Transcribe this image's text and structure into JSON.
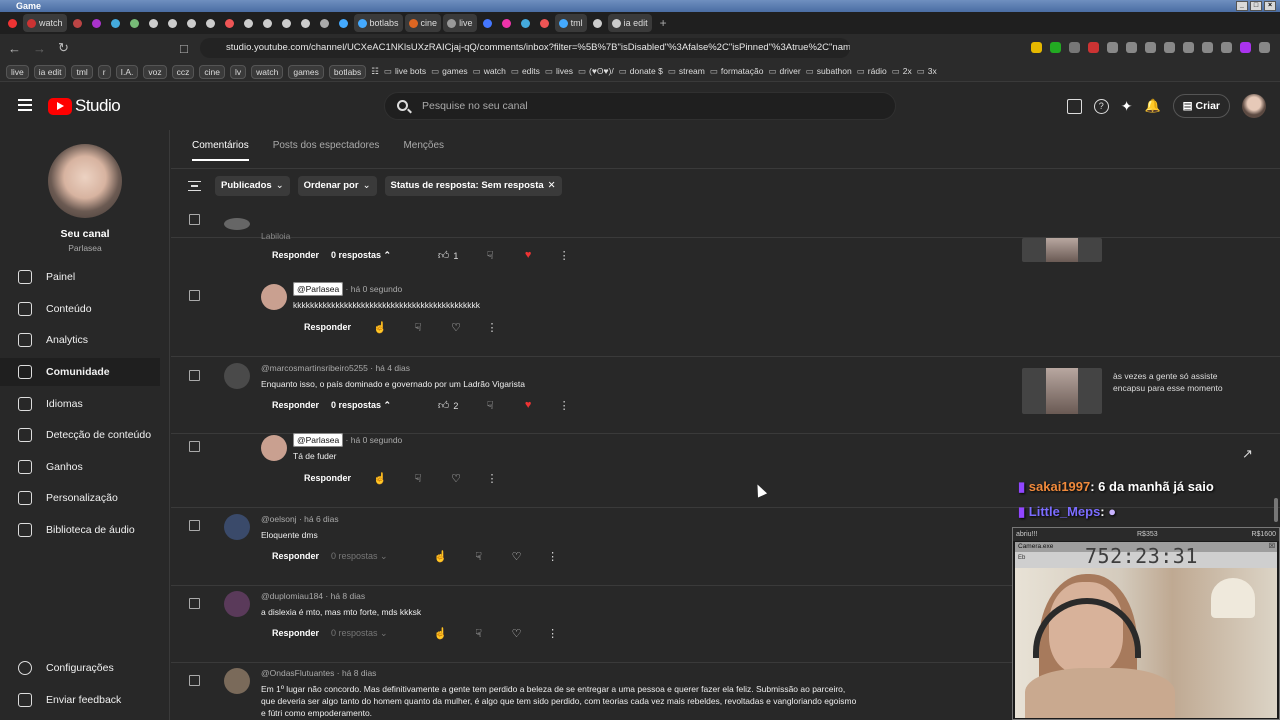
{
  "window": {
    "title": "Game"
  },
  "tabs": [
    {
      "label": "",
      "color": "#e33"
    },
    {
      "label": "watch",
      "color": "#c33",
      "active": true
    },
    {
      "label": "",
      "color": "#b44"
    },
    {
      "label": "",
      "color": "#a3c"
    },
    {
      "label": "",
      "color": "#4ad"
    },
    {
      "label": "",
      "color": "#7b7"
    },
    {
      "label": "",
      "color": "#ccc"
    },
    {
      "label": "",
      "color": "#ccc"
    },
    {
      "label": "",
      "color": "#ccc"
    },
    {
      "label": "",
      "color": "#ccc"
    },
    {
      "label": "",
      "color": "#e55"
    },
    {
      "label": "",
      "color": "#ccc"
    },
    {
      "label": "",
      "color": "#ccc"
    },
    {
      "label": "",
      "color": "#ccc"
    },
    {
      "label": "",
      "color": "#ccc"
    },
    {
      "label": "",
      "color": "#aaa"
    },
    {
      "label": "",
      "color": "#4af"
    },
    {
      "label": "botlabs",
      "color": "#4af"
    },
    {
      "label": "cine",
      "color": "#d62"
    },
    {
      "label": "live",
      "color": "#999"
    },
    {
      "label": "",
      "color": "#47f"
    },
    {
      "label": "",
      "color": "#e3a"
    },
    {
      "label": "",
      "color": "#4ad"
    },
    {
      "label": "",
      "color": "#e55"
    },
    {
      "label": "tml",
      "color": "#4af"
    },
    {
      "label": "",
      "color": "#ccc"
    },
    {
      "label": "ia edit",
      "color": "#ccc"
    }
  ],
  "url": "studio.youtube.com/channel/UCXeAC1NKlsUXzRAICjaj-qQ/comments/inbox?filter=%5B%7B\"isDisabled\"%3Afalse%2C\"isPinned\"%3Atrue%2C\"nam...",
  "bookmarks": {
    "chips": [
      "live",
      "ia edit",
      "tml",
      "r",
      "I.A.",
      "voz",
      "ccz",
      "cine",
      "lv",
      "watch",
      "games",
      "botlabs"
    ],
    "folders": [
      "live bots",
      "games",
      "watch",
      "edits",
      "lives",
      "(♥ʘ♥)/",
      "donate $",
      "stream",
      "formatação",
      "driver",
      "subathon",
      "rádio",
      "2x",
      "3x"
    ]
  },
  "header": {
    "logo": "Studio",
    "search_placeholder": "Pesquise no seu canal",
    "create_label": "Criar"
  },
  "channel": {
    "name": "Seu canal",
    "handle": "Parlasea"
  },
  "nav": [
    {
      "label": "Painel",
      "icon": "dashboard-icon"
    },
    {
      "label": "Conteúdo",
      "icon": "content-icon"
    },
    {
      "label": "Analytics",
      "icon": "analytics-icon"
    },
    {
      "label": "Comunidade",
      "icon": "community-icon",
      "active": true
    },
    {
      "label": "Idiomas",
      "icon": "subtitles-icon"
    },
    {
      "label": "Detecção de conteúdo",
      "icon": "copyright-icon"
    },
    {
      "label": "Ganhos",
      "icon": "dollar-icon"
    },
    {
      "label": "Personalização",
      "icon": "customize-icon"
    },
    {
      "label": "Biblioteca de áudio",
      "icon": "audio-library-icon"
    }
  ],
  "nav_bottom": [
    {
      "label": "Configurações",
      "icon": "gear-icon"
    },
    {
      "label": "Enviar feedback",
      "icon": "feedback-icon"
    }
  ],
  "page_tabs": [
    "Comentários",
    "Posts dos espectadores",
    "Menções"
  ],
  "filters": {
    "published": "Publicados",
    "sort": "Ordenar por",
    "status": "Status de resposta: Sem resposta"
  },
  "labels": {
    "reply": "Responder"
  },
  "comments": [
    {
      "author": "",
      "time": "",
      "text": "Labiloia",
      "replies": "0 respostas",
      "likes": "1",
      "show_replies": true
    },
    {
      "author": "@Parlasea",
      "time": "há 0 segundo",
      "text": "kkkkkkkkkkkkkkkkkkkkkkkkkkkkkkkkkkkkkkkkkkkk",
      "owner": true
    },
    {
      "author": "@marcosmartinsribeiro5255",
      "time": "há 4 dias",
      "text": "Enquanto isso, o país dominado e governado por um Ladrão Vigarista",
      "replies": "0 respostas",
      "likes": "2",
      "show_replies": true
    },
    {
      "author": "@Parlasea",
      "time": "há 0 segundo",
      "text": "Tá de fuder",
      "owner": true
    },
    {
      "author": "@oelsonj",
      "time": "há 6 dias",
      "text": "Eloquente dms",
      "replies": "0 respostas",
      "likes": ""
    },
    {
      "author": "@duplomiau184",
      "time": "há 8 dias",
      "text": "a dislexia é mto, mas mto forte, mds kkksk",
      "replies": "0 respostas",
      "likes": ""
    },
    {
      "author": "@OndasFlutuantes",
      "time": "há 8 dias",
      "text": "Em 1º lugar não concordo. Mas definitivamente a gente tem perdido a beleza de se entregar a uma pessoa e querer fazer ela feliz. Submissão ao parceiro,",
      "text2": "que deveria ser algo tanto do homem quanto da mulher, é algo que tem sido perdido, com teorias cada vez mais rebeldes, revoltadas e vangloriando egoismo",
      "text3": "e fútri como empoderamento."
    }
  ],
  "video_ref": {
    "title": "às vezes a gente só assiste encapsu para esse momento"
  },
  "stream_chat": [
    {
      "user": "sakai1997",
      "message": ": 6 da manhã já saio",
      "color": "#f08a3c"
    },
    {
      "user": "Little_Meps",
      "message": ":",
      "color": "#7b6cff"
    }
  ],
  "overlay": {
    "left": "abriu!!!",
    "mid": "R$353",
    "right": "R$1600",
    "cam_title": "Camera.exe",
    "cam_sub": "Eb",
    "timer": "752:23:31"
  }
}
